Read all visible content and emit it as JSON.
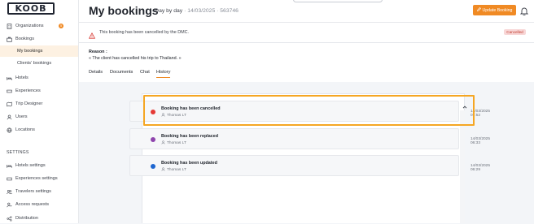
{
  "logo": "KOOB",
  "sidebar": {
    "items": [
      {
        "label": "Organizations",
        "icon": "building-icon",
        "badge": "5"
      },
      {
        "label": "Bookings",
        "icon": "briefcase-icon"
      },
      {
        "label": "My bookings",
        "sub": true,
        "active": true
      },
      {
        "label": "Clients' bookings",
        "sub": true
      },
      {
        "label": "Hotels",
        "icon": "bed-icon"
      },
      {
        "label": "Experiences",
        "icon": "ticket-icon"
      },
      {
        "label": "Trip Designer",
        "icon": "map-icon"
      },
      {
        "label": "Users",
        "icon": "user-icon"
      },
      {
        "label": "Locations",
        "icon": "globe-icon"
      }
    ],
    "settings_label": "SETTINGS",
    "settings": [
      {
        "label": "Hotels settings",
        "icon": "bed-icon"
      },
      {
        "label": "Experiences settings",
        "icon": "ticket-icon"
      },
      {
        "label": "Travelers settings",
        "icon": "users-icon"
      },
      {
        "label": "Access requests",
        "icon": "user-key-icon"
      },
      {
        "label": "Distribution",
        "icon": "share-icon"
      }
    ]
  },
  "header": {
    "title": "My bookings",
    "separator": "·",
    "type": "Day by day",
    "date_id": "· 14/03/2025 · 563746",
    "update_label": "Update Booking"
  },
  "alert": {
    "text": "This booking has been cancelled by the DMC.",
    "status": "Cancelled"
  },
  "reason": {
    "label": "Reason :",
    "text": "« The client has cancelled his trip to Thailand. »"
  },
  "tabs": [
    "Details",
    "Documents",
    "Chat",
    "History"
  ],
  "active_tab": "History",
  "history": [
    {
      "title": "Booking has been cancelled",
      "user": "Thomas LT",
      "date": "14/03/2025 07:52",
      "color": "#e53935"
    },
    {
      "title": "Booking has been replaced",
      "user": "Thomas LT",
      "date": "14/03/2025 06:33",
      "color": "#8e44ad"
    },
    {
      "title": "Booking has been updated",
      "user": "Thomas LT",
      "date": "14/03/2025 06:29",
      "color": "#1e66d0"
    }
  ],
  "colors": {
    "accent": "#f08a24",
    "highlight": "#f5a623"
  }
}
